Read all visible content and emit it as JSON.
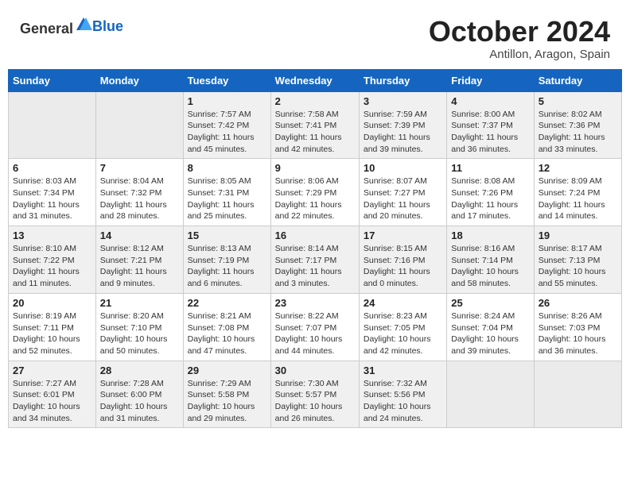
{
  "header": {
    "logo_general": "General",
    "logo_blue": "Blue",
    "month": "October 2024",
    "location": "Antillon, Aragon, Spain"
  },
  "weekdays": [
    "Sunday",
    "Monday",
    "Tuesday",
    "Wednesday",
    "Thursday",
    "Friday",
    "Saturday"
  ],
  "weeks": [
    [
      {
        "day": "",
        "info": ""
      },
      {
        "day": "",
        "info": ""
      },
      {
        "day": "1",
        "info": "Sunrise: 7:57 AM\nSunset: 7:42 PM\nDaylight: 11 hours and 45 minutes."
      },
      {
        "day": "2",
        "info": "Sunrise: 7:58 AM\nSunset: 7:41 PM\nDaylight: 11 hours and 42 minutes."
      },
      {
        "day": "3",
        "info": "Sunrise: 7:59 AM\nSunset: 7:39 PM\nDaylight: 11 hours and 39 minutes."
      },
      {
        "day": "4",
        "info": "Sunrise: 8:00 AM\nSunset: 7:37 PM\nDaylight: 11 hours and 36 minutes."
      },
      {
        "day": "5",
        "info": "Sunrise: 8:02 AM\nSunset: 7:36 PM\nDaylight: 11 hours and 33 minutes."
      }
    ],
    [
      {
        "day": "6",
        "info": "Sunrise: 8:03 AM\nSunset: 7:34 PM\nDaylight: 11 hours and 31 minutes."
      },
      {
        "day": "7",
        "info": "Sunrise: 8:04 AM\nSunset: 7:32 PM\nDaylight: 11 hours and 28 minutes."
      },
      {
        "day": "8",
        "info": "Sunrise: 8:05 AM\nSunset: 7:31 PM\nDaylight: 11 hours and 25 minutes."
      },
      {
        "day": "9",
        "info": "Sunrise: 8:06 AM\nSunset: 7:29 PM\nDaylight: 11 hours and 22 minutes."
      },
      {
        "day": "10",
        "info": "Sunrise: 8:07 AM\nSunset: 7:27 PM\nDaylight: 11 hours and 20 minutes."
      },
      {
        "day": "11",
        "info": "Sunrise: 8:08 AM\nSunset: 7:26 PM\nDaylight: 11 hours and 17 minutes."
      },
      {
        "day": "12",
        "info": "Sunrise: 8:09 AM\nSunset: 7:24 PM\nDaylight: 11 hours and 14 minutes."
      }
    ],
    [
      {
        "day": "13",
        "info": "Sunrise: 8:10 AM\nSunset: 7:22 PM\nDaylight: 11 hours and 11 minutes."
      },
      {
        "day": "14",
        "info": "Sunrise: 8:12 AM\nSunset: 7:21 PM\nDaylight: 11 hours and 9 minutes."
      },
      {
        "day": "15",
        "info": "Sunrise: 8:13 AM\nSunset: 7:19 PM\nDaylight: 11 hours and 6 minutes."
      },
      {
        "day": "16",
        "info": "Sunrise: 8:14 AM\nSunset: 7:17 PM\nDaylight: 11 hours and 3 minutes."
      },
      {
        "day": "17",
        "info": "Sunrise: 8:15 AM\nSunset: 7:16 PM\nDaylight: 11 hours and 0 minutes."
      },
      {
        "day": "18",
        "info": "Sunrise: 8:16 AM\nSunset: 7:14 PM\nDaylight: 10 hours and 58 minutes."
      },
      {
        "day": "19",
        "info": "Sunrise: 8:17 AM\nSunset: 7:13 PM\nDaylight: 10 hours and 55 minutes."
      }
    ],
    [
      {
        "day": "20",
        "info": "Sunrise: 8:19 AM\nSunset: 7:11 PM\nDaylight: 10 hours and 52 minutes."
      },
      {
        "day": "21",
        "info": "Sunrise: 8:20 AM\nSunset: 7:10 PM\nDaylight: 10 hours and 50 minutes."
      },
      {
        "day": "22",
        "info": "Sunrise: 8:21 AM\nSunset: 7:08 PM\nDaylight: 10 hours and 47 minutes."
      },
      {
        "day": "23",
        "info": "Sunrise: 8:22 AM\nSunset: 7:07 PM\nDaylight: 10 hours and 44 minutes."
      },
      {
        "day": "24",
        "info": "Sunrise: 8:23 AM\nSunset: 7:05 PM\nDaylight: 10 hours and 42 minutes."
      },
      {
        "day": "25",
        "info": "Sunrise: 8:24 AM\nSunset: 7:04 PM\nDaylight: 10 hours and 39 minutes."
      },
      {
        "day": "26",
        "info": "Sunrise: 8:26 AM\nSunset: 7:03 PM\nDaylight: 10 hours and 36 minutes."
      }
    ],
    [
      {
        "day": "27",
        "info": "Sunrise: 7:27 AM\nSunset: 6:01 PM\nDaylight: 10 hours and 34 minutes."
      },
      {
        "day": "28",
        "info": "Sunrise: 7:28 AM\nSunset: 6:00 PM\nDaylight: 10 hours and 31 minutes."
      },
      {
        "day": "29",
        "info": "Sunrise: 7:29 AM\nSunset: 5:58 PM\nDaylight: 10 hours and 29 minutes."
      },
      {
        "day": "30",
        "info": "Sunrise: 7:30 AM\nSunset: 5:57 PM\nDaylight: 10 hours and 26 minutes."
      },
      {
        "day": "31",
        "info": "Sunrise: 7:32 AM\nSunset: 5:56 PM\nDaylight: 10 hours and 24 minutes."
      },
      {
        "day": "",
        "info": ""
      },
      {
        "day": "",
        "info": ""
      }
    ]
  ]
}
